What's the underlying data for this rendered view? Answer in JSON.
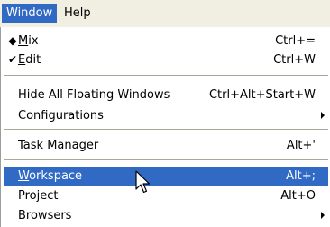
{
  "menubar": {
    "items": [
      {
        "label": "Window",
        "active": true
      },
      {
        "label": "Help",
        "active": false
      }
    ]
  },
  "menu": {
    "items": [
      {
        "mark": "◆",
        "label_u": "M",
        "label_rest": "ix",
        "shortcut": "Ctrl+="
      },
      {
        "mark": "✔",
        "label_u": "E",
        "label_rest": "dit",
        "shortcut": "Ctrl+W"
      },
      {
        "label": "Hide All Floating Windows",
        "shortcut": "Ctrl+Alt+Start+W"
      },
      {
        "label": "Configurations",
        "submenu": true
      },
      {
        "label_u": "T",
        "label_rest": "ask Manager",
        "shortcut": "Alt+'"
      },
      {
        "label_u": "W",
        "label_rest": "orkspace",
        "shortcut": "Alt+;",
        "highlighted": true
      },
      {
        "label": "Project",
        "shortcut": "Alt+O"
      },
      {
        "label": "Browsers",
        "submenu": true
      }
    ]
  },
  "colors": {
    "highlight": "#316ac5",
    "menubar_bg": "#f1efe2"
  },
  "icons": {
    "cursor": "mouse-pointer-icon",
    "submenu_arrow": "submenu-arrow-icon"
  }
}
